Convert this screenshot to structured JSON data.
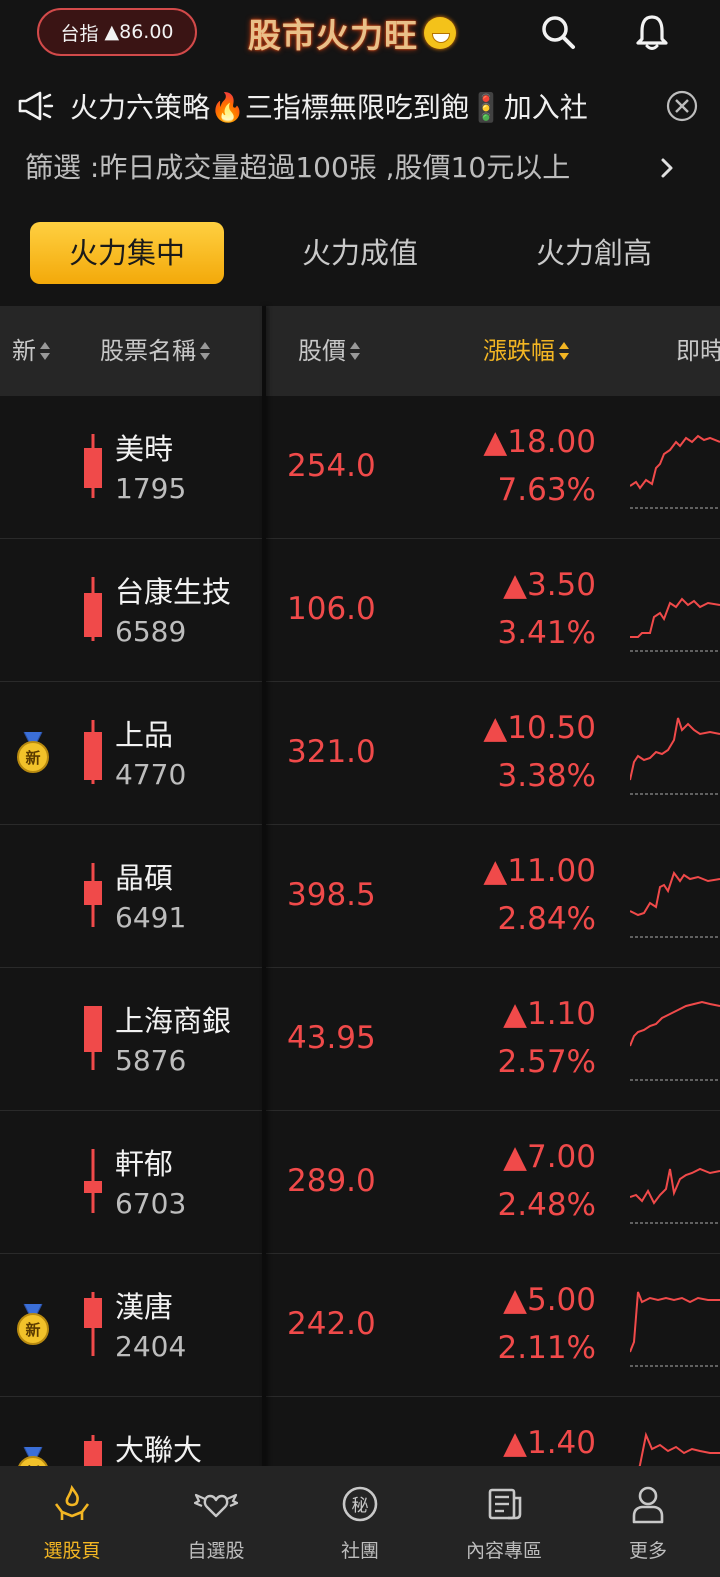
{
  "header": {
    "index_label": "台指",
    "index_value": "▲86.00",
    "app_title": "股市火力旺"
  },
  "announcement": {
    "text": "火力六策略🔥三指標無限吃到飽🚦加入社"
  },
  "filter": {
    "text": "篩選 :昨日成交量超過100張 ,股價10元以上"
  },
  "tabs": [
    {
      "label": "火力集中",
      "active": true
    },
    {
      "label": "火力成值",
      "active": false
    },
    {
      "label": "火力創高",
      "active": false
    }
  ],
  "columns": {
    "new": "新",
    "name": "股票名稱",
    "price": "股價",
    "change": "漲跌幅",
    "realtime": "即時"
  },
  "rows": [
    {
      "name": "美時",
      "code": "1795",
      "price": "254.0",
      "change": "▲18.00",
      "pct": "7.63%",
      "is_new": false
    },
    {
      "name": "台康生技",
      "code": "6589",
      "price": "106.0",
      "change": "▲3.50",
      "pct": "3.41%",
      "is_new": false
    },
    {
      "name": "上品",
      "code": "4770",
      "price": "321.0",
      "change": "▲10.50",
      "pct": "3.38%",
      "is_new": true
    },
    {
      "name": "晶碩",
      "code": "6491",
      "price": "398.5",
      "change": "▲11.00",
      "pct": "2.84%",
      "is_new": false
    },
    {
      "name": "上海商銀",
      "code": "5876",
      "price": "43.95",
      "change": "▲1.10",
      "pct": "2.57%",
      "is_new": false
    },
    {
      "name": "軒郁",
      "code": "6703",
      "price": "289.0",
      "change": "▲7.00",
      "pct": "2.48%",
      "is_new": false
    },
    {
      "name": "漢唐",
      "code": "2404",
      "price": "242.0",
      "change": "▲5.00",
      "pct": "2.11%",
      "is_new": true
    },
    {
      "name": "大聯大",
      "code": "",
      "price": "",
      "change": "▲1.40",
      "pct": "",
      "is_new": true
    }
  ],
  "medal_label": "新",
  "nav": [
    {
      "label": "選股頁",
      "icon": "hand-flame-icon",
      "active": true
    },
    {
      "label": "自選股",
      "icon": "winged-heart-icon",
      "active": false
    },
    {
      "label": "社團",
      "icon": "secret-badge-icon",
      "active": false
    },
    {
      "label": "內容專區",
      "icon": "newspaper-icon",
      "active": false
    },
    {
      "label": "更多",
      "icon": "person-icon",
      "active": false
    }
  ],
  "nav_secret_glyph": "秘",
  "colors": {
    "up": "#f04a4a",
    "accent": "#f3b623",
    "background": "#141414"
  }
}
